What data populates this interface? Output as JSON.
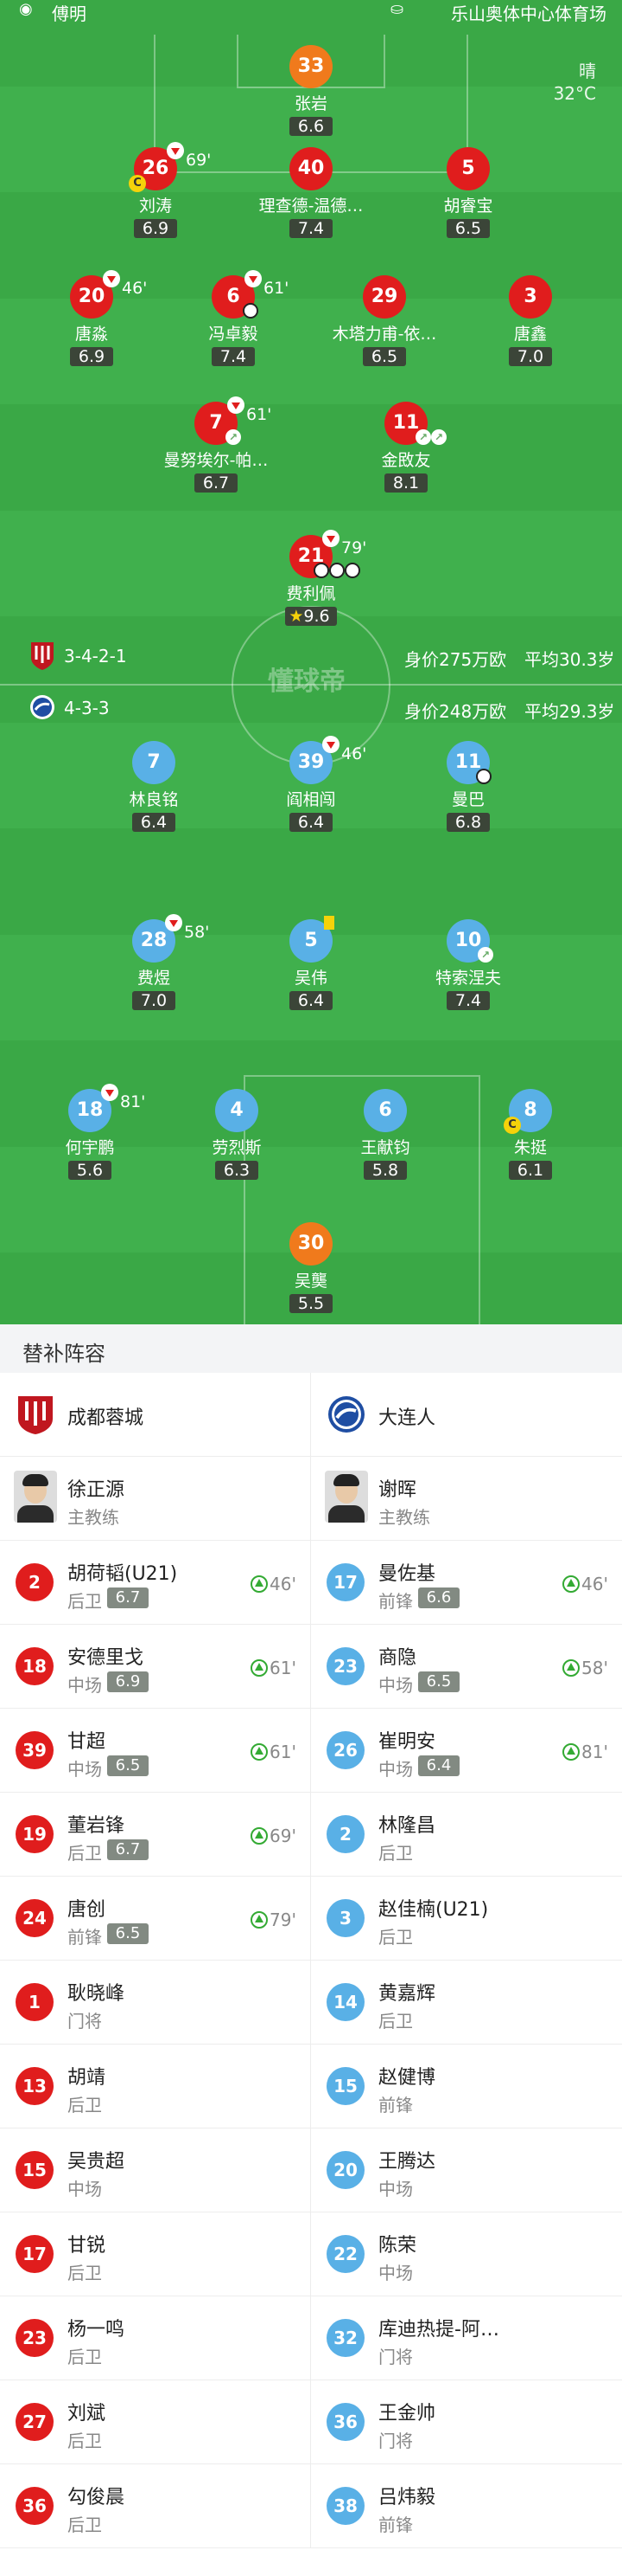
{
  "header": {
    "left_label": "傅明",
    "venue": "乐山奥体中心体育场",
    "weather": "晴",
    "temperature": "32°C"
  },
  "home_team_info": {
    "formation": "3-4-2-1",
    "market_value": "身价275万欧",
    "avg_age": "平均30.3岁"
  },
  "away_team_info": {
    "formation": "4-3-3",
    "market_value": "身价248万欧",
    "avg_age": "平均29.3岁"
  },
  "watermark": "懂球帝",
  "home_players": [
    {
      "num": "33",
      "name": "张岩",
      "rating": "6.6",
      "style": "orange"
    },
    {
      "num": "26",
      "name": "刘涛",
      "rating": "6.9",
      "sub": "69'",
      "captain": "C"
    },
    {
      "num": "40",
      "name": "理查德-温德…",
      "rating": "7.4"
    },
    {
      "num": "5",
      "name": "胡睿宝",
      "rating": "6.5"
    },
    {
      "num": "20",
      "name": "唐淼",
      "rating": "6.9",
      "sub": "46'"
    },
    {
      "num": "6",
      "name": "冯卓毅",
      "rating": "7.4",
      "sub": "61'"
    },
    {
      "num": "29",
      "name": "木塔力甫-依…",
      "rating": "6.5"
    },
    {
      "num": "3",
      "name": "唐鑫",
      "rating": "7.0"
    },
    {
      "num": "7",
      "name": "曼努埃尔-帕…",
      "rating": "6.7",
      "sub": "61'"
    },
    {
      "num": "11",
      "name": "金敃友",
      "rating": "8.1"
    },
    {
      "num": "21",
      "name": "费利佩",
      "rating": "9.6",
      "sub": "79'"
    }
  ],
  "away_players": [
    {
      "num": "7",
      "name": "林良铭",
      "rating": "6.4"
    },
    {
      "num": "39",
      "name": "阎相闯",
      "rating": "6.4",
      "sub": "46'"
    },
    {
      "num": "11",
      "name": "曼巴",
      "rating": "6.8"
    },
    {
      "num": "28",
      "name": "费煜",
      "rating": "7.0",
      "sub": "58'"
    },
    {
      "num": "5",
      "name": "吴伟",
      "rating": "6.4"
    },
    {
      "num": "10",
      "name": "特索涅夫",
      "rating": "7.4"
    },
    {
      "num": "18",
      "name": "何宇鹏",
      "rating": "5.6",
      "sub": "81'"
    },
    {
      "num": "4",
      "name": "劳烈斯",
      "rating": "6.3"
    },
    {
      "num": "6",
      "name": "王献钧",
      "rating": "5.8"
    },
    {
      "num": "8",
      "name": "朱挺",
      "rating": "6.1",
      "captain": "C"
    },
    {
      "num": "30",
      "name": "吴龑",
      "rating": "5.5"
    }
  ],
  "subs": {
    "title": "替补阵容",
    "home_team": "成都蓉城",
    "away_team": "大连人",
    "home_coach": {
      "name": "徐正源",
      "role": "主教练"
    },
    "away_coach": {
      "name": "谢晖",
      "role": "主教练"
    },
    "home": [
      {
        "num": "2",
        "name": "胡荷韬(U21)",
        "pos": "后卫",
        "rating": "6.7",
        "time": "46'"
      },
      {
        "num": "18",
        "name": "安德里戈",
        "pos": "中场",
        "rating": "6.9",
        "time": "61'"
      },
      {
        "num": "39",
        "name": "甘超",
        "pos": "中场",
        "rating": "6.5",
        "time": "61'"
      },
      {
        "num": "19",
        "name": "董岩锋",
        "pos": "后卫",
        "rating": "6.7",
        "time": "69'"
      },
      {
        "num": "24",
        "name": "唐创",
        "pos": "前锋",
        "rating": "6.5",
        "time": "79'"
      },
      {
        "num": "1",
        "name": "耿晓峰",
        "pos": "门将"
      },
      {
        "num": "13",
        "name": "胡靖",
        "pos": "后卫"
      },
      {
        "num": "15",
        "name": "吴贵超",
        "pos": "中场"
      },
      {
        "num": "17",
        "name": "甘锐",
        "pos": "后卫"
      },
      {
        "num": "23",
        "name": "杨一鸣",
        "pos": "后卫"
      },
      {
        "num": "27",
        "name": "刘斌",
        "pos": "后卫"
      },
      {
        "num": "36",
        "name": "勾俊晨",
        "pos": "后卫"
      }
    ],
    "away": [
      {
        "num": "17",
        "name": "曼佐基",
        "pos": "前锋",
        "rating": "6.6",
        "time": "46'"
      },
      {
        "num": "23",
        "name": "商隐",
        "pos": "中场",
        "rating": "6.5",
        "time": "58'"
      },
      {
        "num": "26",
        "name": "崔明安",
        "pos": "中场",
        "rating": "6.4",
        "time": "81'"
      },
      {
        "num": "2",
        "name": "林隆昌",
        "pos": "后卫"
      },
      {
        "num": "3",
        "name": "赵佳楠(U21)",
        "pos": "后卫"
      },
      {
        "num": "14",
        "name": "黄嘉辉",
        "pos": "后卫"
      },
      {
        "num": "15",
        "name": "赵健博",
        "pos": "前锋"
      },
      {
        "num": "20",
        "name": "王腾达",
        "pos": "中场"
      },
      {
        "num": "22",
        "name": "陈荣",
        "pos": "中场"
      },
      {
        "num": "32",
        "name": "库迪热提-阿…",
        "pos": "门将"
      },
      {
        "num": "36",
        "name": "王金帅",
        "pos": "门将"
      },
      {
        "num": "38",
        "name": "吕炜毅",
        "pos": "前锋"
      }
    ]
  }
}
